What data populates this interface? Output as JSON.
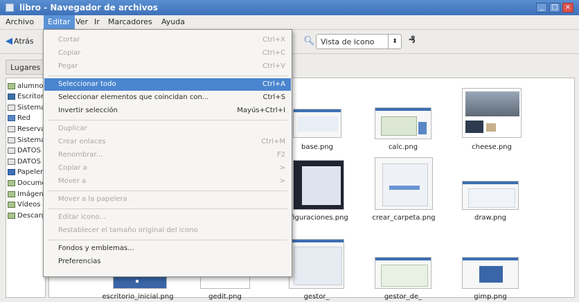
{
  "window": {
    "title": "libro - Navegador de archivos"
  },
  "menubar": [
    "Archivo",
    "Editar",
    "Ver",
    "Ir",
    "Marcadores",
    "Ayuda"
  ],
  "toolbar": {
    "back_label": "Atrás",
    "view_mode": "Vista de icono"
  },
  "places_label": "Lugares",
  "sidebar": [
    {
      "label": "alumno",
      "icon": "folder-icon"
    },
    {
      "label": "Escritorio",
      "icon": "desktop-icon"
    },
    {
      "label": "Sistema de archivos",
      "icon": "drive-icon"
    },
    {
      "label": "Red",
      "icon": "network-icon"
    },
    {
      "label": "Reservado del sistema",
      "icon": "drive-icon"
    },
    {
      "label": "Sistema",
      "icon": "drive-icon"
    },
    {
      "label": "DATOS",
      "icon": "drive-icon"
    },
    {
      "label": "DATOS",
      "icon": "drive-icon"
    },
    {
      "label": "Papelera",
      "icon": "trash-icon"
    },
    {
      "label": "Documentos",
      "icon": "folder-icon"
    },
    {
      "label": "Imágenes",
      "icon": "folder-icon"
    },
    {
      "label": "Vídeos",
      "icon": "folder-icon"
    },
    {
      "label": "Descargas",
      "icon": "folder-icon"
    }
  ],
  "edit_menu": [
    {
      "label": "Cortar",
      "accel": "Ctrl+X",
      "disabled": true
    },
    {
      "label": "Copiar",
      "accel": "Ctrl+C",
      "disabled": true
    },
    {
      "label": "Pegar",
      "accel": "Ctrl+V",
      "disabled": true
    },
    {
      "sep": true
    },
    {
      "label": "Seleccionar todo",
      "accel": "Ctrl+A",
      "highlighted": true
    },
    {
      "label": "Seleccionar elementos que coincidan con...",
      "accel": "Ctrl+S"
    },
    {
      "label": "Invertir selección",
      "accel": "Mayús+Ctrl+I"
    },
    {
      "sep": true
    },
    {
      "label": "Duplicar",
      "accel": "",
      "disabled": true
    },
    {
      "label": "Crear enlaces",
      "accel": "Ctrl+M",
      "disabled": true
    },
    {
      "label": "Renombrar...",
      "accel": "F2",
      "disabled": true
    },
    {
      "label": "Copiar a",
      "accel": ">",
      "disabled": true
    },
    {
      "label": "Mover a",
      "accel": ">",
      "disabled": true
    },
    {
      "sep": true
    },
    {
      "label": "Mover a la papelera",
      "accel": "",
      "disabled": true
    },
    {
      "sep": true
    },
    {
      "label": "Editar icono...",
      "accel": "",
      "disabled": true
    },
    {
      "label": "Restablecer el tamaño original del icono",
      "accel": "",
      "disabled": true
    },
    {
      "sep": true
    },
    {
      "label": "Fondos y emblemas...",
      "accel": ""
    },
    {
      "label": "Preferencias",
      "accel": ""
    }
  ],
  "files": [
    {
      "name": "base.png"
    },
    {
      "name": "calc.png"
    },
    {
      "name": "cheese.png"
    },
    {
      "name": "figuraciones.png"
    },
    {
      "name": "crear_carpeta.png"
    },
    {
      "name": "draw.png"
    },
    {
      "name": "escritorio_inicial.png"
    },
    {
      "name": "gedit.png"
    },
    {
      "name": "gestor_"
    },
    {
      "name": "gestor_de_"
    },
    {
      "name": "gimp.png"
    }
  ]
}
